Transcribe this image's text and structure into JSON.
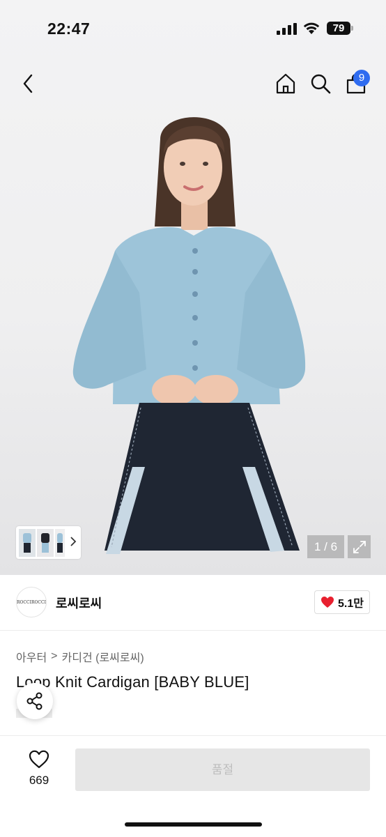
{
  "status_bar": {
    "time": "22:47",
    "battery": "79"
  },
  "nav": {
    "cart_count": "9"
  },
  "gallery": {
    "counter": "1 / 6"
  },
  "brand": {
    "logo_text": "ROCCIROCCI",
    "name": "로씨로씨",
    "likes": "5.1만"
  },
  "breadcrumb": {
    "level1": "아우터",
    "separator": ">",
    "level2": "카디건 (로씨로씨)"
  },
  "product": {
    "title": "Loop Knit Cardigan [BABY BLUE]"
  },
  "bottom": {
    "wish_count": "669",
    "buy_label": "품절"
  },
  "colors": {
    "accent": "#2f6cf0",
    "heart": "#e8202f",
    "disabled_button": "#e6e6e6"
  }
}
